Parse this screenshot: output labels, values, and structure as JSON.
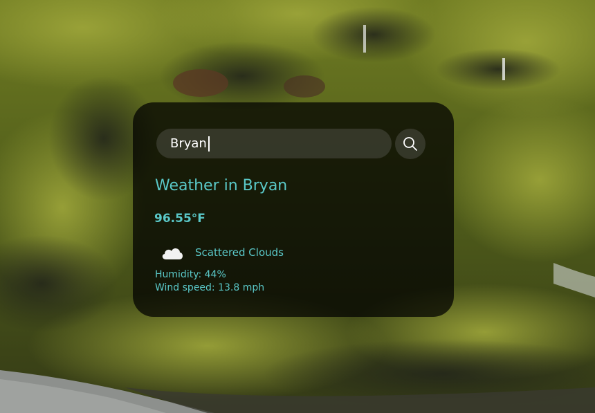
{
  "background": {
    "description_colors": {
      "moss": "#7a8a22",
      "moss_light": "#a3a637",
      "rock": "#2a2a1e",
      "river": "#8a8c8a"
    }
  },
  "search": {
    "value": "Bryan",
    "button_icon": "search-icon"
  },
  "weather": {
    "title": "Weather in Bryan",
    "temperature": "96.55°F",
    "condition_icon": "cloud-icon",
    "condition": "Scattered Clouds",
    "humidity": "Humidity: 44%",
    "wind": "Wind speed: 13.8 mph"
  },
  "colors": {
    "accent": "#5ac8c8",
    "card_background": "rgba(0,0,0,0.72)",
    "input_background": "rgba(124,124,124,0.28)",
    "input_text": "#ffffff"
  }
}
